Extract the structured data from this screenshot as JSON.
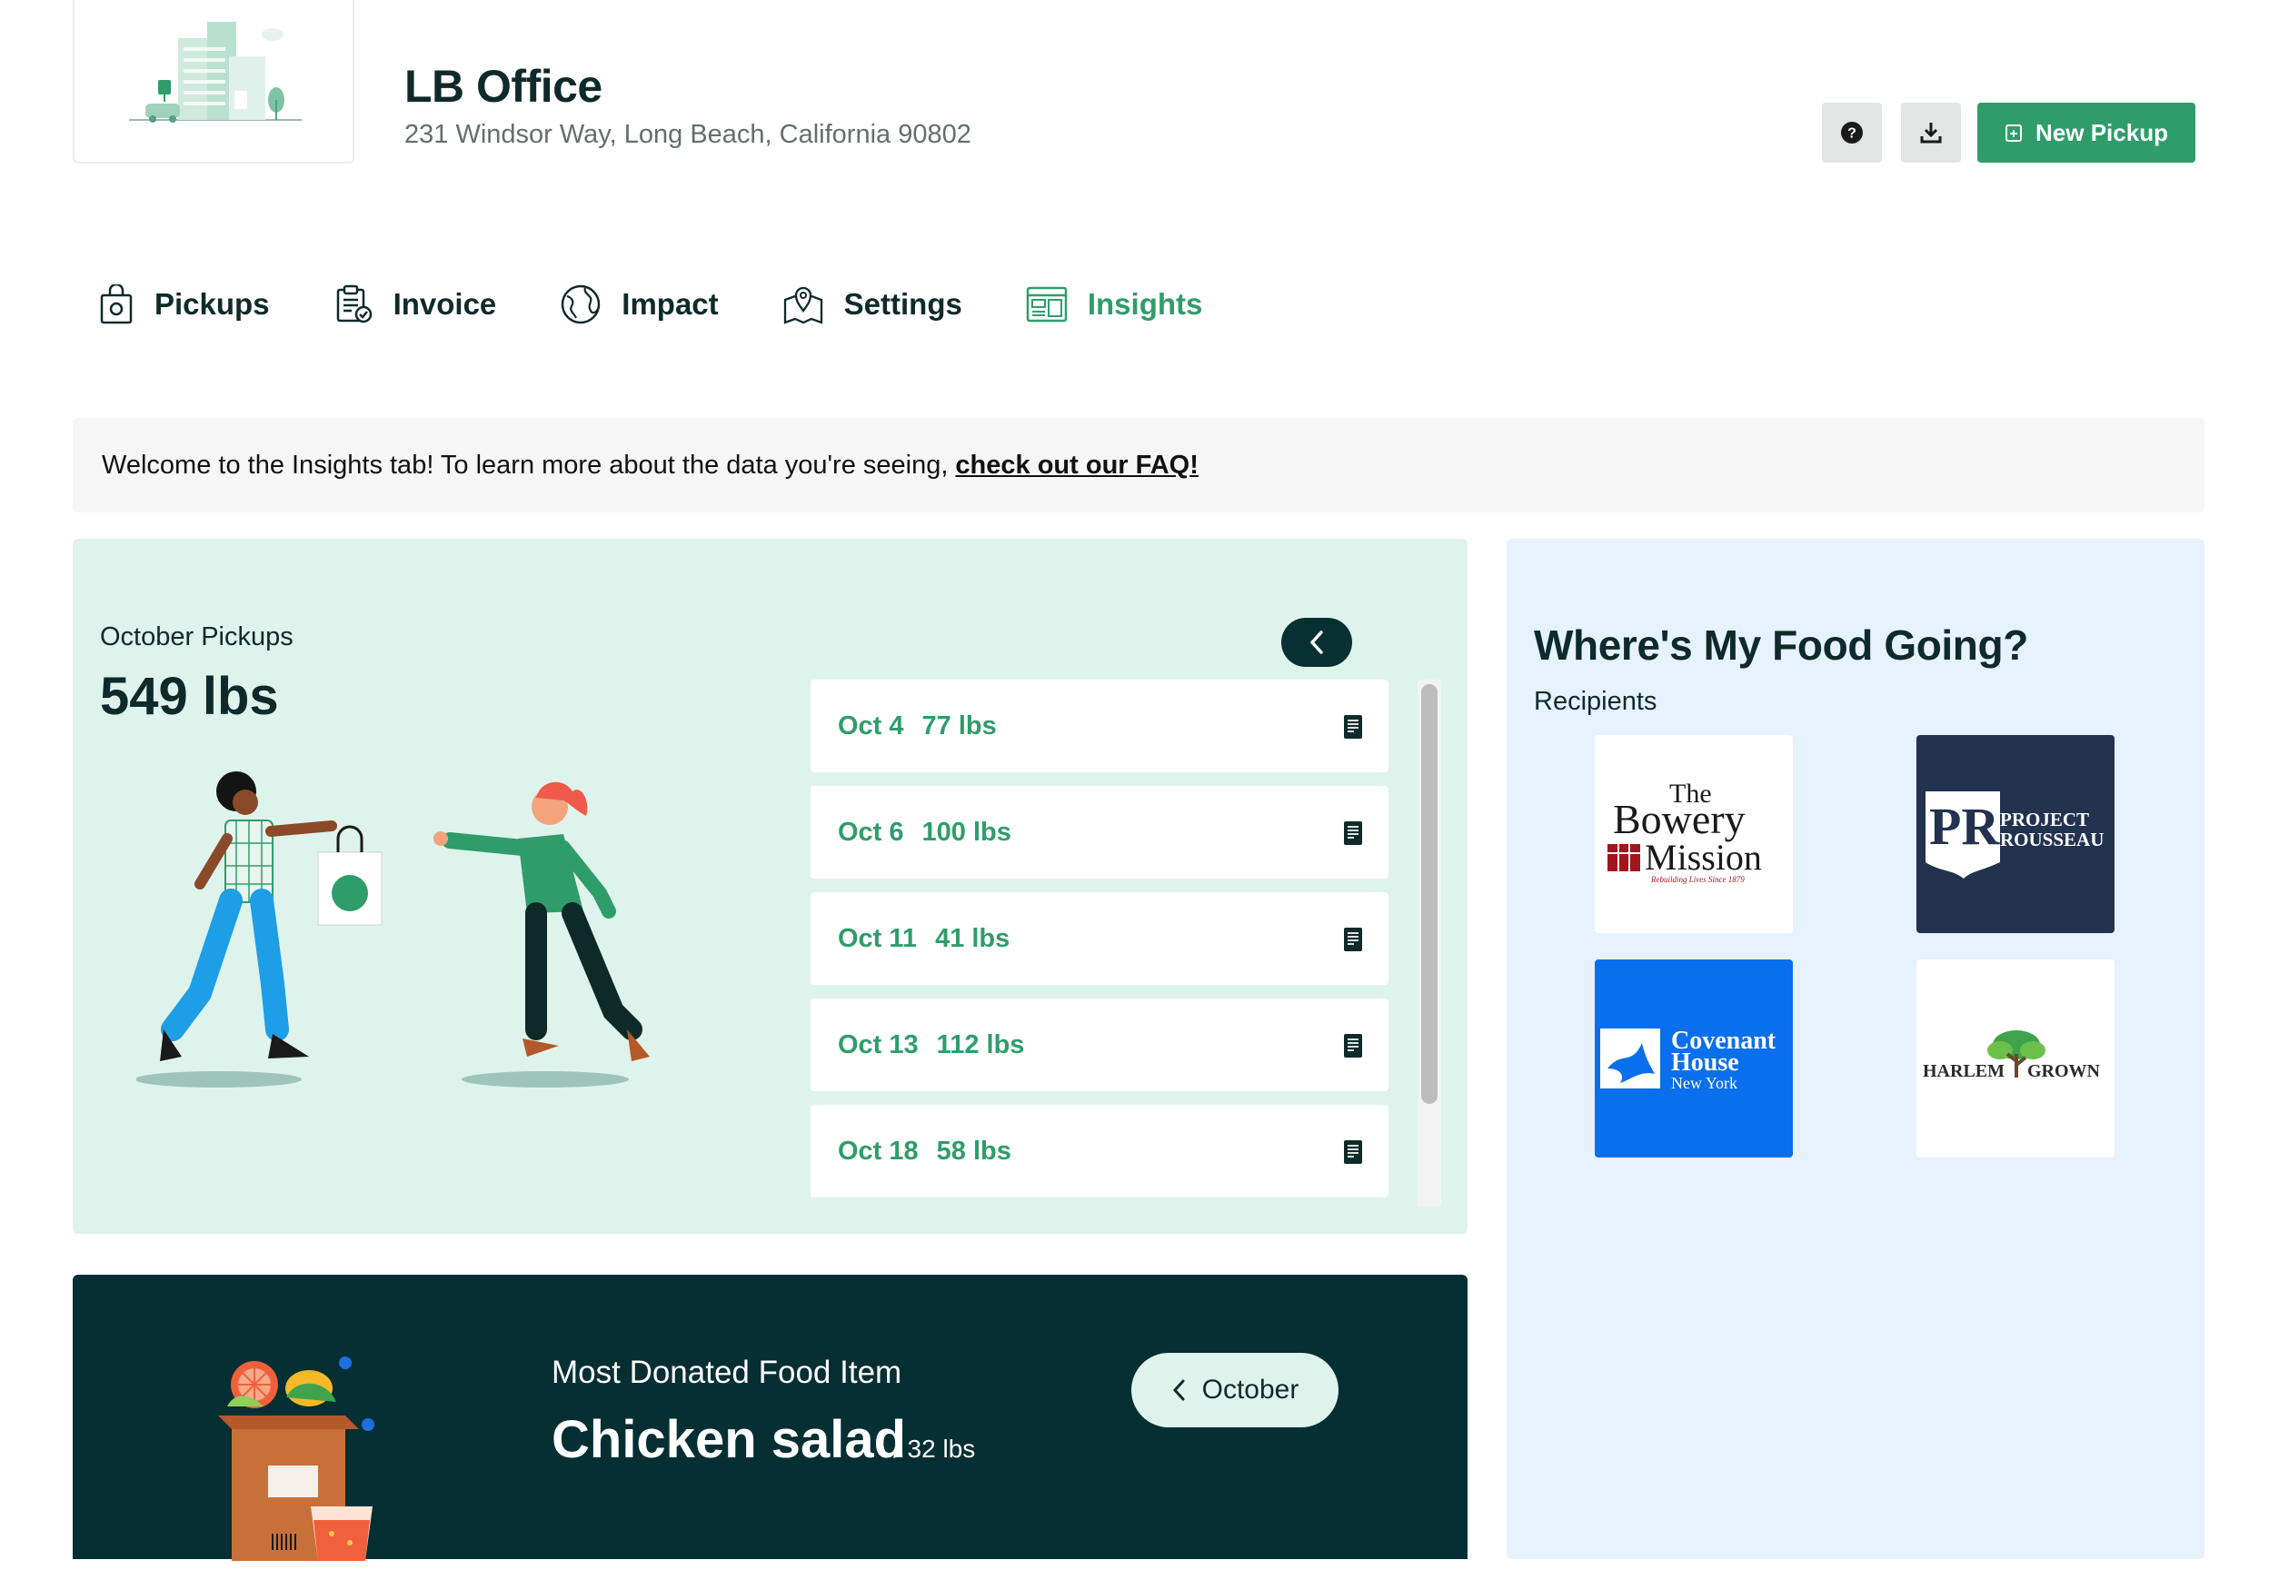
{
  "header": {
    "title": "LB Office",
    "address": "231 Windsor Way, Long Beach, California 90802",
    "new_pickup_label": "New Pickup"
  },
  "tabs": [
    {
      "label": "Pickups",
      "icon": "bag-icon"
    },
    {
      "label": "Invoice",
      "icon": "clipboard-icon"
    },
    {
      "label": "Impact",
      "icon": "globe-icon"
    },
    {
      "label": "Settings",
      "icon": "map-pin-icon"
    },
    {
      "label": "Insights",
      "icon": "dashboard-icon",
      "active": true
    }
  ],
  "banner": {
    "text": "Welcome to the Insights tab! To learn more about the data you're seeing,",
    "link": "check out our FAQ!"
  },
  "pickups": {
    "label": "October Pickups",
    "total": "549 lbs",
    "items": [
      {
        "date": "Oct 4",
        "weight": "77 lbs"
      },
      {
        "date": "Oct 6",
        "weight": "100 lbs"
      },
      {
        "date": "Oct 11",
        "weight": "41 lbs"
      },
      {
        "date": "Oct 13",
        "weight": "112 lbs"
      },
      {
        "date": "Oct 18",
        "weight": "58 lbs"
      }
    ]
  },
  "donated": {
    "label": "Most Donated Food Item",
    "item": "Chicken salad",
    "weight": "/ 32 lbs",
    "month": "October"
  },
  "food_going": {
    "title": "Where's My Food Going?",
    "recipients_label": "Recipients",
    "recipients": [
      {
        "line1": "The",
        "line2": "Bowery",
        "line3": "Mission",
        "tagline": "Rebuilding Lives Since 1879"
      },
      {
        "monogram": "PR",
        "line1": "PROJECT",
        "line2": "ROUSSEAU"
      },
      {
        "line1": "Covenant",
        "line2": "House",
        "line3": "New York"
      },
      {
        "line1": "HARLEM",
        "line2": "GROWN"
      }
    ]
  },
  "colors": {
    "brand_green": "#2f9d6a",
    "dark_teal": "#052f33",
    "mint": "#def3ec",
    "light_blue": "#e6f2fd"
  }
}
